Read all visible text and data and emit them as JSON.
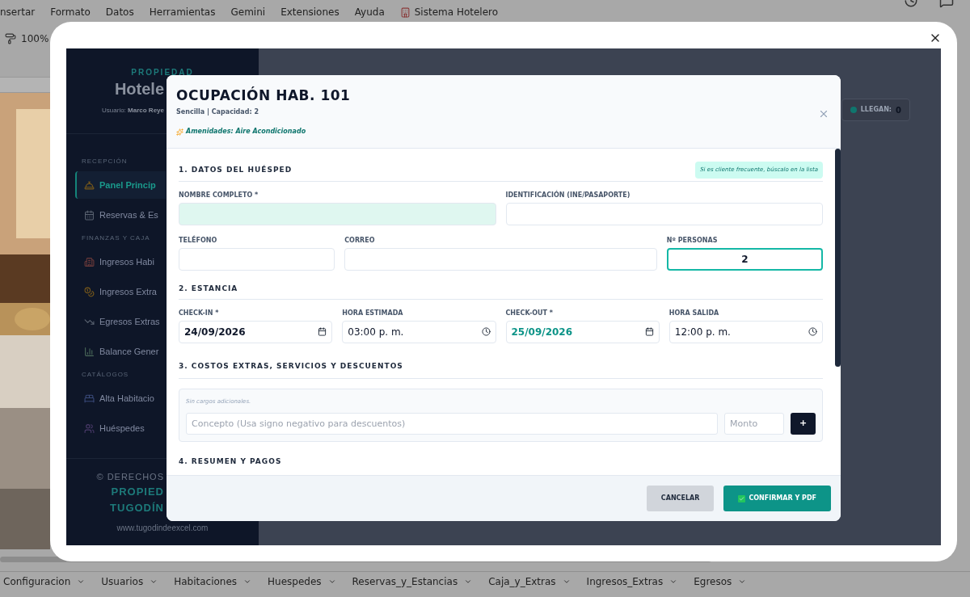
{
  "menu_bar": [
    "nsertar",
    "Formato",
    "Datos",
    "Herramientas",
    "Gemini",
    "Extensiones",
    "Ayuda",
    "Sistema Hotelero"
  ],
  "toolbar": {
    "zoom": "100%"
  },
  "app": {
    "sidebar": {
      "eyebrow": "PROPIEDAD",
      "title": "Hotele",
      "user_label": "Usuario:",
      "user_name": "Marco Reye",
      "sections": [
        {
          "heading": "RECEPCIÓN",
          "items": [
            {
              "label": "Panel Princip",
              "selected": true
            },
            {
              "label": "Reservas & Es",
              "selected": false
            }
          ]
        },
        {
          "heading": "FINANZAS Y CAJA",
          "items": [
            {
              "label": "Ingresos Habi",
              "selected": false
            },
            {
              "label": "Ingresos Extra",
              "selected": false
            },
            {
              "label": "Egresos Extras",
              "selected": false
            },
            {
              "label": "Balance Gener",
              "selected": false
            }
          ]
        },
        {
          "heading": "CATÁLOGOS",
          "items": [
            {
              "label": "Alta Habitacio",
              "selected": false
            },
            {
              "label": "Huéspedes",
              "selected": false
            }
          ]
        }
      ],
      "footer": {
        "copyright": "© DERECHOS",
        "brand": [
          "PROPIED",
          "TUGODÍN"
        ],
        "url": "www.tugodindeexcel.com"
      }
    },
    "stat": {
      "label": "LLEGAN:",
      "value": "0"
    }
  },
  "modal": {
    "title": "OCUPACIÓN HAB. 101",
    "subtitle": "Sencilla | Capacidad: 2",
    "amenities": "Amenidades: Aire Acondicionado",
    "sections": [
      {
        "heading": "1. DATOS DEL HUÉSPED",
        "hint": "Si es cliente frecuente, búscalo en la lista",
        "rows": [
          [
            {
              "label": "NOMBRE COMPLETO *",
              "kind": "text",
              "highlighted": true,
              "focused": false
            },
            {
              "label": "IDENTIFICACIÓN (INE/PASAPORTE)",
              "kind": "text",
              "highlighted": false,
              "focused": false
            }
          ],
          [
            {
              "label": "TELÉFONO",
              "kind": "text",
              "highlighted": false,
              "focused": false
            },
            {
              "label": "CORREO",
              "kind": "text",
              "highlighted": false,
              "focused": false
            },
            {
              "label": "Nº PERSONAS",
              "kind": "number",
              "value": "2",
              "highlighted": false,
              "focused": true
            }
          ]
        ]
      },
      {
        "heading": "2. ESTANCIA",
        "rows": [
          [
            {
              "label": "CHECK-IN *",
              "kind": "date",
              "value": "24/09/2026",
              "highlighted": false,
              "focused": false
            },
            {
              "label": "HORA ESTIMADA",
              "kind": "time",
              "value": "03:00 p. m.",
              "highlighted": false,
              "focused": false
            },
            {
              "label": "CHECK-OUT *",
              "kind": "date",
              "value": "25/09/2026",
              "highlighted": true,
              "focused": false
            },
            {
              "label": "HORA SALIDA",
              "kind": "time",
              "value": "12:00 p. m.",
              "highlighted": false,
              "focused": false
            }
          ]
        ]
      }
    ],
    "extras": {
      "heading": "3. COSTOS EXTRAS, SERVICIOS Y DESCUENTOS",
      "empty_note": "Sin cargos adicionales.",
      "concept_placeholder": "Concepto (Usa signo negativo para descuentos)",
      "amount_placeholder": "Monto",
      "add_button": "+"
    },
    "next_heading": "4. RESUMEN Y PAGOS",
    "buttons": {
      "cancel": "CANCELAR",
      "confirm": "CONFIRMAR Y PDF"
    }
  },
  "sheet_tabs": [
    "Configuracion",
    "Usuarios",
    "Habitaciones",
    "Huespedes",
    "Reservas_y_Estancias",
    "Caja_y_Extras",
    "Ingresos_Extras",
    "Egresos"
  ]
}
